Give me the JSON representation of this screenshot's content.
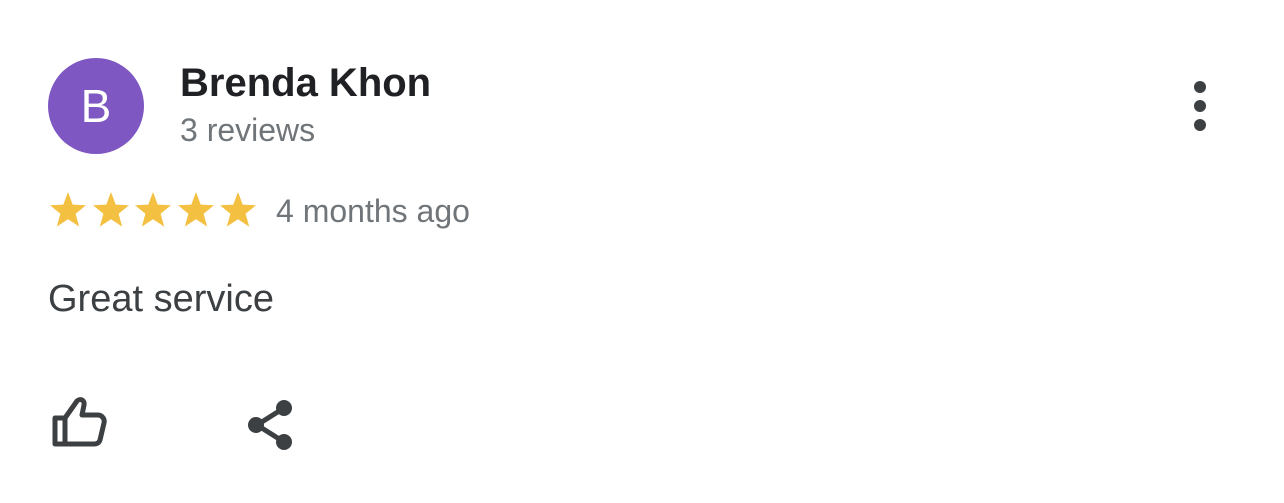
{
  "reviewer": {
    "initial": "B",
    "name": "Brenda Khon",
    "review_count": "3 reviews",
    "avatar_color": "#7e57c2"
  },
  "review": {
    "rating": 5,
    "max_rating": 5,
    "star_color": "#f4c042",
    "time_ago": "4 months ago",
    "text": "Great service"
  },
  "icons": {
    "more": "more-vert-icon",
    "like": "thumb-up-icon",
    "share": "share-icon"
  },
  "colors": {
    "text_primary": "#202124",
    "text_secondary": "#70757a",
    "body_text": "#3c4043",
    "icon": "#3c4043"
  }
}
